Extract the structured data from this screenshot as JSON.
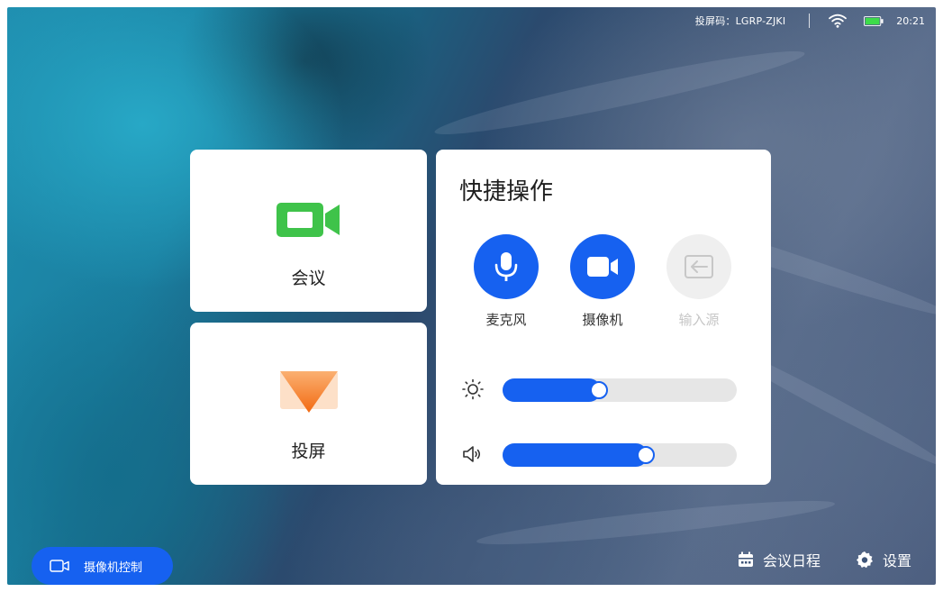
{
  "status": {
    "cast_code": "投屏码：LGRP-ZJKI",
    "time": "20:21"
  },
  "tiles": {
    "meeting_label": "会议",
    "cast_label": "投屏"
  },
  "quick_panel": {
    "title": "快捷操作",
    "buttons": [
      {
        "label": "麦克风",
        "icon": "microphone-icon",
        "enabled": true
      },
      {
        "label": "摄像机",
        "icon": "camera-icon",
        "enabled": true
      },
      {
        "label": "输入源",
        "icon": "input-source-icon",
        "enabled": false
      }
    ],
    "brightness": {
      "icon": "brightness-icon",
      "level": 0.42
    },
    "volume": {
      "icon": "speaker-icon",
      "level": 0.62
    }
  },
  "bottom": {
    "camera_control_label": "摄像机控制",
    "schedule_label": "会议日程",
    "settings_label": "设置"
  },
  "colors": {
    "accent": "#1661f0",
    "meeting_icon": "#3fc34a",
    "cast_icon": "#f47c1e"
  }
}
